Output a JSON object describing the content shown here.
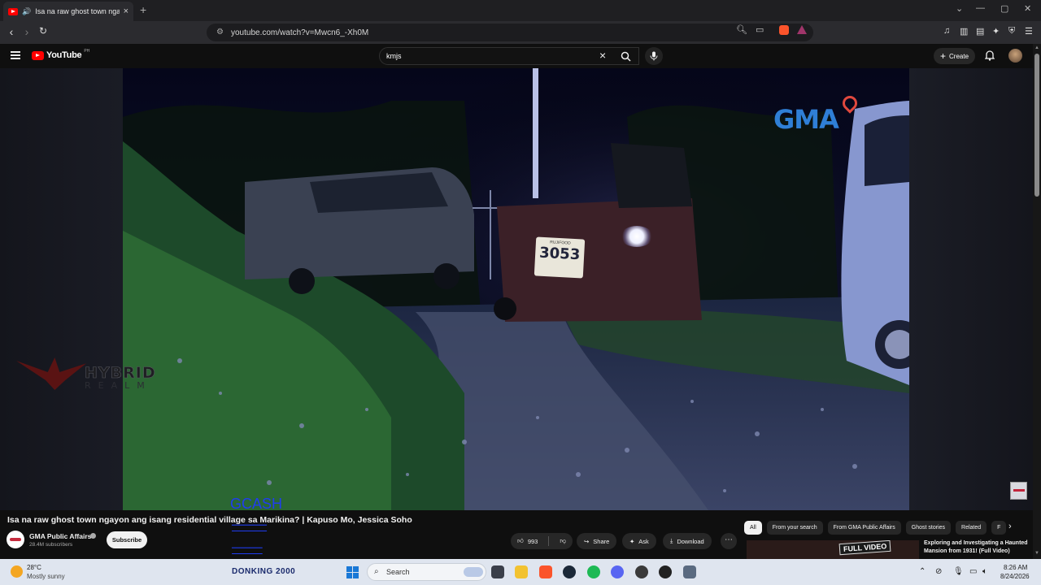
{
  "browser": {
    "tab_title": "Isa na raw ghost town ngayon ang isang residential village sa Marikina? | Kapuso Mo, Jessica Soho - YouTube",
    "url": "youtube.com/watch?v=Mwcn6_-Xh0M"
  },
  "header": {
    "logo_text": "YouTube",
    "region_code": "PH",
    "search_value": "kmjs",
    "create_label": "Create"
  },
  "video": {
    "watermark_broadcaster": "GMA",
    "plate_small": "RUJIFOOD",
    "plate_number": "3053",
    "overlay_brand_top": "HYBRID",
    "overlay_brand_bottom": "REALM",
    "overlay_gcash": "GCASH",
    "title": "Isa na raw ghost town ngayon ang isang residential village sa Marikina? | Kapuso Mo, Jessica Soho"
  },
  "channel": {
    "name": "GMA Public Affairs",
    "subscribers": "28.4M subscribers",
    "subscribe_label": "Subscribe"
  },
  "actions": {
    "likes": "993",
    "share": "Share",
    "ask": "Ask",
    "download": "Download"
  },
  "chips": [
    "All",
    "From your search",
    "From GMA Public Affairs",
    "Ghost stories",
    "Related",
    "F"
  ],
  "recommendation": {
    "thumb_label": "FULL VIDEO",
    "title": "Exploring and Investigating a Haunted Mansion from 1931! (Full Video)"
  },
  "taskbar": {
    "temperature": "28°C",
    "weather": "Mostly sunny",
    "widget_text": "DONKING 2000",
    "search_label": "Search",
    "time": "8:26 AM",
    "date": "8/24/2026"
  },
  "colors": {
    "youtube_red": "#ff0000",
    "gma_blue": "#2f7fd6",
    "gcash_blue": "#1f3df0",
    "taskbar_bg": "#dfe5ef"
  }
}
